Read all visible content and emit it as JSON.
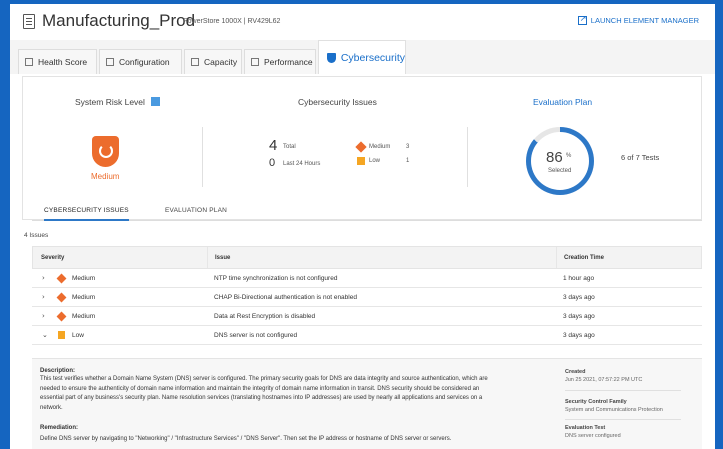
{
  "header": {
    "title": "Manufacturing_Prod",
    "subtitle": "PowerStore 1000X | RV429L62",
    "launch_label": "LAUNCH ELEMENT MANAGER"
  },
  "tabs": [
    {
      "label": "Health Score"
    },
    {
      "label": "Configuration"
    },
    {
      "label": "Capacity"
    },
    {
      "label": "Performance"
    },
    {
      "label": "Cybersecurity"
    }
  ],
  "summary": {
    "risk_title": "System Risk Level",
    "risk_value": "Medium",
    "issues_title": "Cybersecurity Issues",
    "total_num": "4",
    "total_label": "Total",
    "last24_num": "0",
    "last24_label": "Last 24 Hours",
    "medium_label": "Medium",
    "medium_count": "3",
    "low_label": "Low",
    "low_count": "1",
    "eval_title": "Evaluation Plan",
    "eval_percent_num": "86",
    "eval_percent_unit": "%",
    "eval_percent_label": "Selected",
    "eval_fraction": 0.86,
    "tests_text": "6 of 7 Tests"
  },
  "inner_tabs": [
    "CYBERSECURITY ISSUES",
    "EVALUATION PLAN"
  ],
  "issues_count": "4 Issues",
  "table": {
    "headers": [
      "Severity",
      "Issue",
      "Creation Time"
    ],
    "rows": [
      {
        "severity": "Medium",
        "issue": "NTP time synchronization is not configured",
        "time": "1 hour ago",
        "expanded": false
      },
      {
        "severity": "Medium",
        "issue": "CHAP Bi-Directional authentication is not enabled",
        "time": "3 days ago",
        "expanded": false
      },
      {
        "severity": "Medium",
        "issue": "Data at Rest Encryption is disabled",
        "time": "3 days ago",
        "expanded": false
      },
      {
        "severity": "Low",
        "issue": "DNS server is not configured",
        "time": "3 days ago",
        "expanded": true
      }
    ]
  },
  "detail": {
    "description_heading": "Description:",
    "description_lines": [
      "This test verifies whether a Domain Name System (DNS) server is configured. The primary security goals for DNS are data integrity and source authentication, which are",
      "needed to ensure the authenticity of domain name information and maintain the integrity of domain name information in transit. DNS security should be considered an",
      "essential part of any business's security plan. Name resolution services (translating hostnames into IP addresses) are used by nearly all applications and services on a",
      "network."
    ],
    "remediation_heading": "Remediation:",
    "remediation_text": "Define DNS server by navigating to \"Networking\" / \"Infrastructure Services\" / \"DNS Server\". Then set the IP address or hostname of DNS server or servers.",
    "created_label": "Created",
    "created_value": "Jun 25 2021, 07:57:22 PM UTC",
    "family_label": "Security Control Family",
    "family_value": "System and Communications Protection",
    "eval_test_label": "Evaluation Test",
    "eval_test_value": "DNS server configured"
  }
}
